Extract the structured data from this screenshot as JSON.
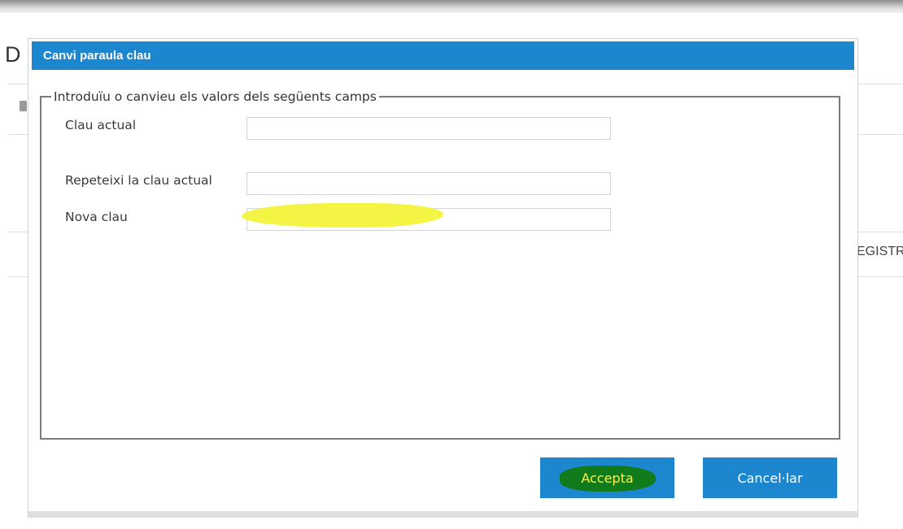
{
  "background": {
    "heading_fragment": "D",
    "right_text_fragment": "EGISTR"
  },
  "dialog": {
    "title": "Canvi paraula clau",
    "group_legend": "Introduïu o canvieu els valors dels següents camps",
    "fields": [
      {
        "label": "Clau actual",
        "value": ""
      },
      {
        "label": "Repeteixi la clau actual",
        "value": ""
      },
      {
        "label": "Nova clau",
        "value": ""
      }
    ],
    "buttons": {
      "accept": "Accepta",
      "cancel": "Cancel·lar"
    }
  },
  "colors": {
    "accent": "#1c87cf",
    "highlight": "#f2f33a",
    "accept_mark": "#117a1b"
  }
}
